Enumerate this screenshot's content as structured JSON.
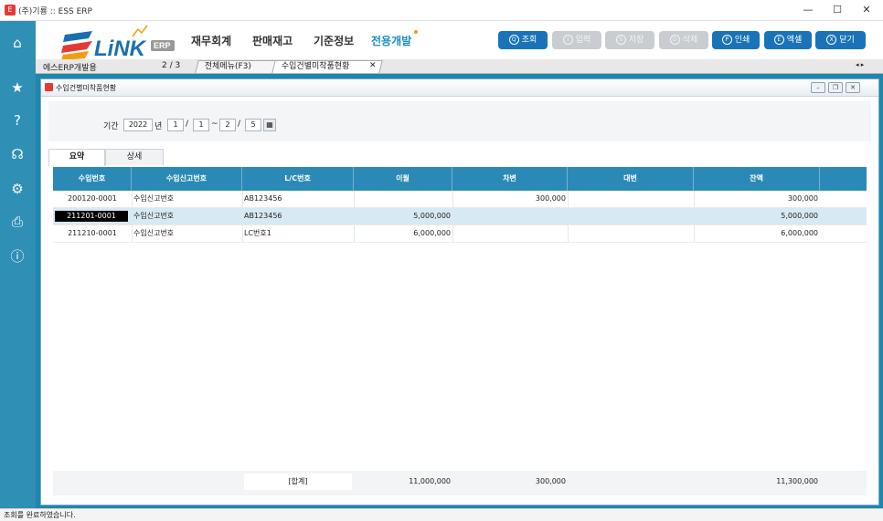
{
  "window": {
    "title": "(주)기룡 :: ESS ERP",
    "minimize": "—",
    "maximize": "☐",
    "close": "✕"
  },
  "logo": {
    "text": "LiNK",
    "badge": "ERP"
  },
  "menu": [
    "재무회계",
    "판매재고",
    "기준정보",
    "전용개발"
  ],
  "toolbar": [
    {
      "key": "Q",
      "label": "조회",
      "enabled": true
    },
    {
      "key": "I",
      "label": "입력",
      "enabled": false
    },
    {
      "key": "S",
      "label": "저장",
      "enabled": false
    },
    {
      "key": "D",
      "label": "삭제",
      "enabled": false
    },
    {
      "key": "P",
      "label": "인쇄",
      "enabled": true
    },
    {
      "key": "E",
      "label": "엑셀",
      "enabled": true
    },
    {
      "key": "X",
      "label": "닫기",
      "enabled": true
    }
  ],
  "tabstrip": {
    "company": "에스ERP개발용",
    "page": "2 / 3",
    "tabs": [
      "전체메뉴(F3)",
      "수입건별미착품현황"
    ],
    "close": "✕",
    "nav": "◂ ▸"
  },
  "form": {
    "title": "수입건별미착품현황",
    "period_label": "기간",
    "year": "2022",
    "year_unit": "년",
    "from_month": "1",
    "from_day": "1",
    "to_month": "2",
    "to_day": "5",
    "slash": "/",
    "tilde": "~",
    "subtabs": [
      "요약",
      "상세"
    ]
  },
  "grid": {
    "columns": [
      "수입번호",
      "수입신고번호",
      "L/C번호",
      "이월",
      "차변",
      "대변",
      "잔액"
    ],
    "rows": [
      {
        "no": "200120-0001",
        "decl": "수입신고번호",
        "lc": "AB123456",
        "carry": "",
        "debit": "300,000",
        "credit": "",
        "balance": "300,000"
      },
      {
        "no": "211201-0001",
        "decl": "수입신고번호",
        "lc": "AB123456",
        "carry": "5,000,000",
        "debit": "",
        "credit": "",
        "balance": "5,000,000"
      },
      {
        "no": "211210-0001",
        "decl": "수입신고번호",
        "lc": "LC번호1",
        "carry": "6,000,000",
        "debit": "",
        "credit": "",
        "balance": "6,000,000"
      }
    ],
    "footer": {
      "label": "[합계]",
      "carry": "11,000,000",
      "debit": "300,000",
      "credit": "",
      "balance": "11,300,000"
    }
  },
  "status": {
    "text": "조회를 완료하였습니다."
  },
  "colors": {
    "sidebar": "#2f8fb5",
    "header": "#2b8ab5",
    "button": "#1a73b8",
    "accent": "#e53935"
  }
}
